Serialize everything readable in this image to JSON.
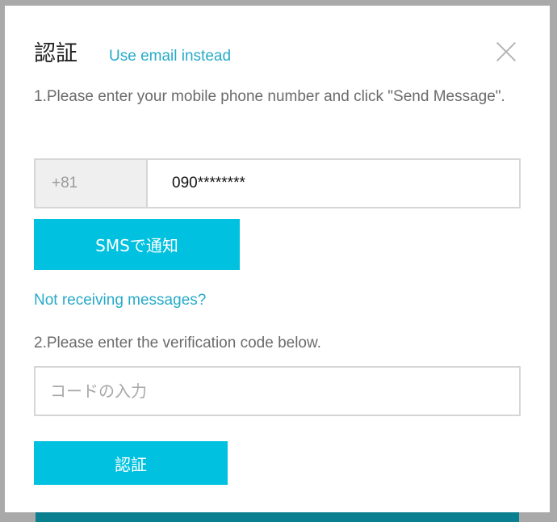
{
  "dialog": {
    "title": "認証",
    "alt_link": "Use email instead",
    "close_icon": "close-icon"
  },
  "step1": {
    "text": "1.Please enter your mobile phone number and click \"Send Message\".",
    "country_code": "+81",
    "phone_value": "090********",
    "send_button": "SMSで通知"
  },
  "help_link": "Not receiving messages?",
  "step2": {
    "text": "2.Please enter the verification code below.",
    "code_placeholder": "コードの入力",
    "verify_button": "認証"
  },
  "colors": {
    "accent": "#00c1e0",
    "link": "#26aac7",
    "backdrop": "#a9a9a9"
  }
}
